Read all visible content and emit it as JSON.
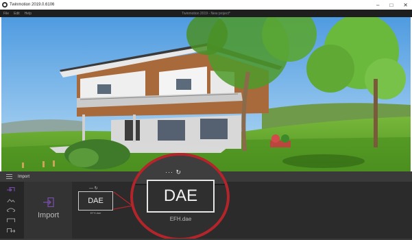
{
  "window": {
    "title": "Twinmotion 2019.0.6106",
    "document_title": "Twinmotion 2019 - New project*",
    "controls": {
      "minimize": "–",
      "maximize": "□",
      "close": "✕"
    }
  },
  "menu": {
    "items": [
      "File",
      "Edit",
      "Help"
    ]
  },
  "import_panel": {
    "header_label": "Import",
    "import_button_label": "Import",
    "sidebar_icons": [
      "import-icon",
      "terrain-icon",
      "eye-icon",
      "media-icon",
      "export-icon"
    ],
    "asset": {
      "badge": "DAE",
      "file_name": "EFH.dae",
      "controls_icons": [
        "more-icon",
        "sync-icon"
      ]
    }
  },
  "magnifier": {
    "controls": "··· ↻",
    "badge": "DAE",
    "file_name": "EFH.dae",
    "ring_color": "#b3252b"
  },
  "colors": {
    "accent": "#7b4fb0",
    "highlight_ring": "#b3252b"
  }
}
